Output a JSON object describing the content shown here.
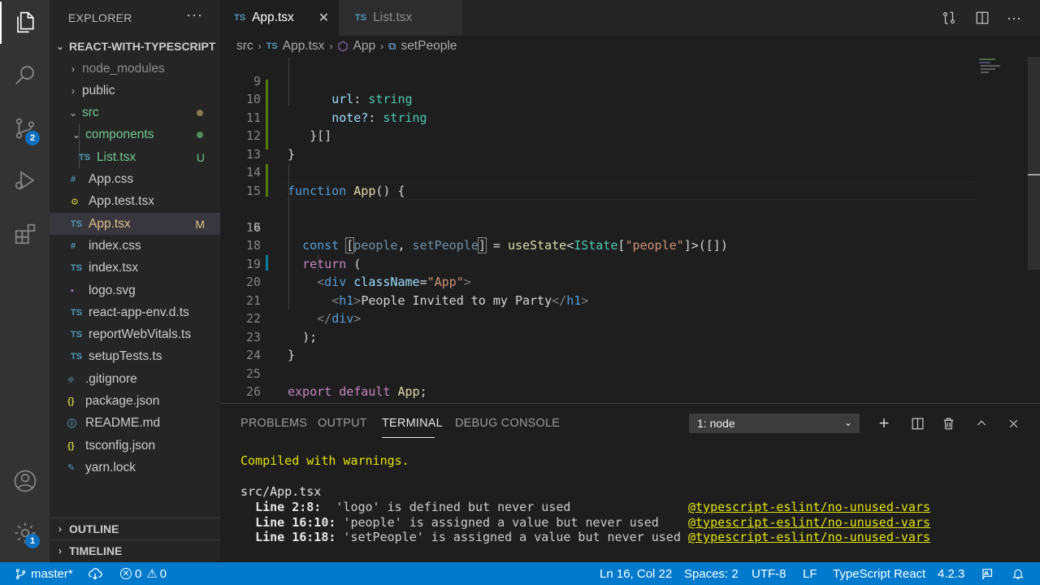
{
  "activity": {
    "scm_badge": "2",
    "settings_badge": "1"
  },
  "sidebar": {
    "title": "EXPLORER",
    "more": "···",
    "project": "REACT-WITH-TYPESCRIPT",
    "tree": [
      {
        "label": "node_modules",
        "type": "folder",
        "color": "#8c8c8c"
      },
      {
        "label": "public",
        "type": "folder",
        "color": "#cccccc"
      },
      {
        "label": "src",
        "type": "folder-open",
        "color": "#73c991"
      },
      {
        "label": "components",
        "type": "folder-open",
        "color": "#73c991"
      },
      {
        "label": "List.tsx",
        "type": "ts",
        "color": "#73c991",
        "status": "U"
      },
      {
        "label": "App.css",
        "type": "css",
        "color": "#cccccc"
      },
      {
        "label": "App.test.tsx",
        "type": "test",
        "color": "#cccccc"
      },
      {
        "label": "App.tsx",
        "type": "ts",
        "color": "#e2c08d",
        "status": "M"
      },
      {
        "label": "index.css",
        "type": "css",
        "color": "#cccccc"
      },
      {
        "label": "index.tsx",
        "type": "ts",
        "color": "#cccccc"
      },
      {
        "label": "logo.svg",
        "type": "svg",
        "color": "#cccccc"
      },
      {
        "label": "react-app-env.d.ts",
        "type": "ts",
        "color": "#cccccc"
      },
      {
        "label": "reportWebVitals.ts",
        "type": "ts",
        "color": "#cccccc"
      },
      {
        "label": "setupTests.ts",
        "type": "ts",
        "color": "#cccccc"
      },
      {
        "label": ".gitignore",
        "type": "git",
        "color": "#cccccc"
      },
      {
        "label": "package.json",
        "type": "json",
        "color": "#cccccc"
      },
      {
        "label": "README.md",
        "type": "info",
        "color": "#cccccc"
      },
      {
        "label": "tsconfig.json",
        "type": "json",
        "color": "#cccccc"
      },
      {
        "label": "yarn.lock",
        "type": "yarn",
        "color": "#cccccc"
      }
    ],
    "file_icon_text": "TS",
    "outline": "OUTLINE",
    "timeline": "TIMELINE"
  },
  "tabs": [
    {
      "label": "App.tsx",
      "prefix": "TS",
      "active": true
    },
    {
      "label": "List.tsx",
      "prefix": "TS",
      "active": false
    }
  ],
  "breadcrumb": {
    "folder": "src",
    "file_prefix": "TS",
    "file": "App.tsx",
    "component": "App",
    "symbol": "setPeople"
  },
  "editor": {
    "line_numbers": [
      "9",
      "10",
      "11",
      "12",
      "13",
      "14",
      "15",
      "16",
      "17",
      "18",
      "19",
      "20",
      "21",
      "22",
      "23",
      "24",
      "25",
      "26"
    ],
    "current_line": "16",
    "code": {
      "l9_prop": "url",
      "l9_type": "string",
      "l10_prop": "note?",
      "l10_type": "string",
      "l11": "}[]",
      "l12": "}",
      "l14_kw": "function",
      "l14_name": "App",
      "l14_rest": "() {",
      "l16_kw": "const",
      "l16_open": "[",
      "l16_a": "people",
      "l16_comma": ", ",
      "l16_b": "setPeople",
      "l16_close": "]",
      "l16_eq": " = ",
      "l16_fn": "useState",
      "l16_lt": "<",
      "l16_type": "IState",
      "l16_br1": "[",
      "l16_str": "\"people\"",
      "l16_br2": "]>([])",
      "l18_kw": "return",
      "l18_rest": " (",
      "l19_open": "<",
      "l19_tag": "div",
      "l19_attr": "className",
      "l19_eq": "=",
      "l19_val": "\"App\"",
      "l19_close": ">",
      "l20_open": "<",
      "l20_tag": "h1",
      "l20_gt": ">",
      "l20_text": "People Invited to my Party",
      "l20_end_open": "</",
      "l20_end_gt": ">",
      "l21_open": "</",
      "l21_tag": "div",
      "l21_gt": ">",
      "l22": ");",
      "l23": "}",
      "l25_kw1": "export",
      "l25_kw2": "default",
      "l25_name": "App",
      "l25_semi": ";"
    }
  },
  "panel": {
    "tabs": [
      "PROBLEMS",
      "OUTPUT",
      "TERMINAL",
      "DEBUG CONSOLE"
    ],
    "active_tab": "TERMINAL",
    "terminal_select": "1: node",
    "terminal": {
      "header": "Compiled with warnings.",
      "file": "src/App.tsx",
      "warnings": [
        {
          "loc": "Line 2:8:",
          "msg": "  'logo' is defined but never used",
          "rule": "@typescript-eslint/no-unused-vars"
        },
        {
          "loc": "Line 16:10:",
          "msg": " 'people' is assigned a value but never used",
          "rule": "@typescript-eslint/no-unused-vars"
        },
        {
          "loc": "Line 16:18:",
          "msg": " 'setPeople' is assigned a value but never used",
          "rule": "@typescript-eslint/no-unused-vars"
        }
      ]
    }
  },
  "statusbar": {
    "branch": "master*",
    "errors": "0",
    "warnings": "0",
    "position": "Ln 16, Col 22",
    "spaces": "Spaces: 2",
    "encoding": "UTF-8",
    "eol": "LF",
    "language": "TypeScript React",
    "version": "4.2.3"
  },
  "colors": {
    "statusbar": "#007acc",
    "activity_bar": "#333333",
    "sidebar": "#252526",
    "editor": "#1e1e1e"
  }
}
